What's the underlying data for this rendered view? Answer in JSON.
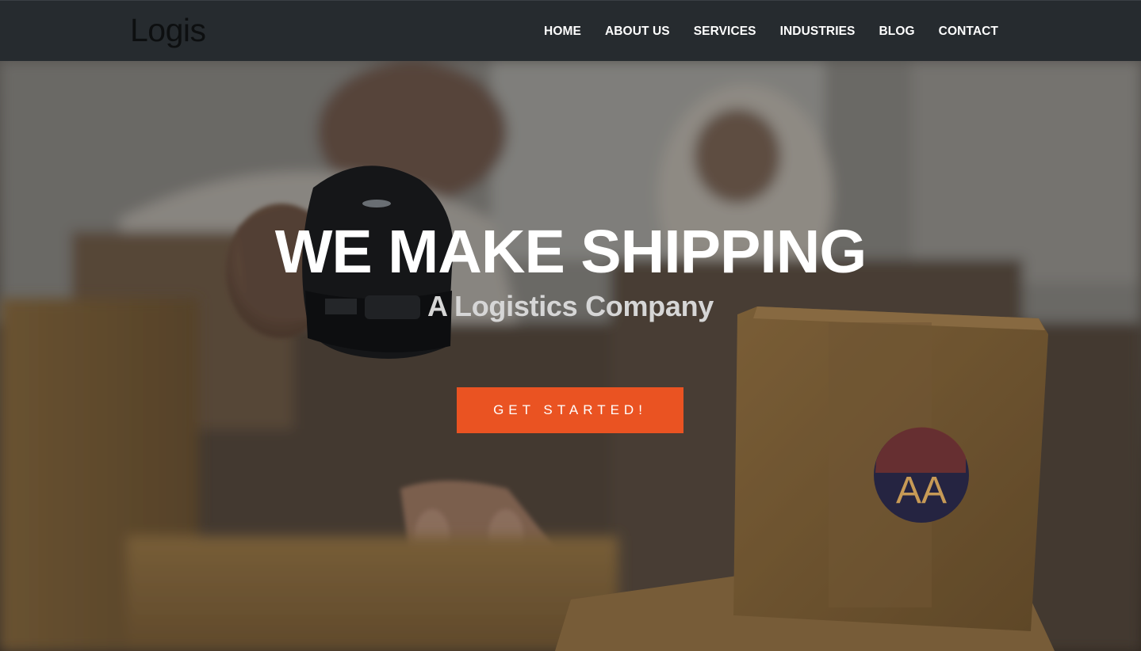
{
  "brand": {
    "logo_text": "Logis"
  },
  "nav": {
    "items": [
      {
        "label": "HOME"
      },
      {
        "label": "ABOUT US"
      },
      {
        "label": "SERVICES"
      },
      {
        "label": "INDUSTRIES"
      },
      {
        "label": "BLOG"
      },
      {
        "label": "CONTACT"
      }
    ]
  },
  "hero": {
    "title": "WE MAKE SHIPPING",
    "subtitle": "A Logistics Company",
    "cta_label": "GET STARTED!",
    "box_label": "AA"
  },
  "colors": {
    "navbar_bg": "#262b2f",
    "accent": "#ea5322",
    "text_light": "#ffffff"
  }
}
